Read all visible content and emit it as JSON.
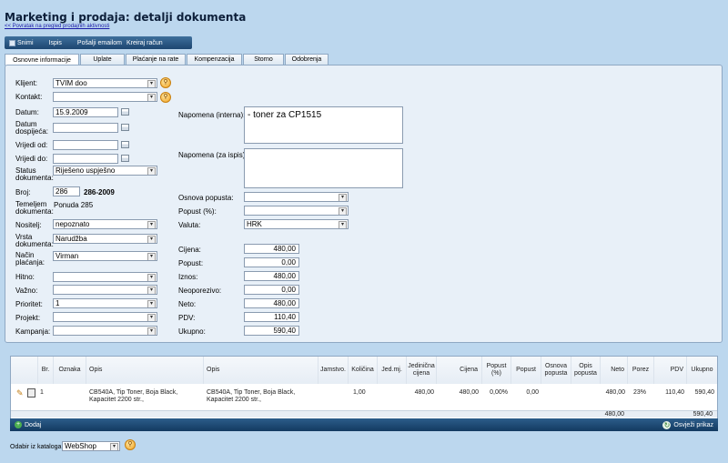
{
  "page": {
    "title": "Marketing i prodaja: detalji dokumenta",
    "back_link": "<< Povratak na pregled prodajnih aktivnosti"
  },
  "toolbar": {
    "save": "Snimi",
    "print": "Ispis",
    "email": "Pošalji emailom",
    "invoice": "Kreiraj račun"
  },
  "tabs": [
    "Osnovne informacije",
    "Uplate",
    "Plaćanje na rate",
    "Kompenzacija",
    "Storno",
    "Odobrenja"
  ],
  "form": {
    "klijent": {
      "label": "Klijent:",
      "value": "TVIM doo"
    },
    "kontakt": {
      "label": "Kontakt:",
      "value": ""
    },
    "datum": {
      "label": "Datum:",
      "value": "15.9.2009"
    },
    "datum_dospijeca": {
      "label": "Datum dospijeća:",
      "value": ""
    },
    "vrijedi_od": {
      "label": "Vrijedi od:",
      "value": ""
    },
    "vrijedi_do": {
      "label": "Vrijedi do:",
      "value": ""
    },
    "status": {
      "label": "Status dokumenta:",
      "value": "Riješeno uspješno"
    },
    "broj": {
      "label": "Broj:",
      "value": "286",
      "full": "286-2009"
    },
    "temeljem": {
      "label": "Temeljem dokumenta:",
      "value": "Ponuda 285"
    },
    "nositelj": {
      "label": "Nositelj:",
      "value": "nepoznato"
    },
    "vrsta": {
      "label": "Vrsta dokumenta:",
      "value": "Narudžba"
    },
    "nacin": {
      "label": "Način plaćanja:",
      "value": "Virman"
    },
    "hitno": {
      "label": "Hitno:",
      "value": ""
    },
    "vazno": {
      "label": "Važno:",
      "value": ""
    },
    "prioritet": {
      "label": "Prioritet:",
      "value": "1"
    },
    "projekt": {
      "label": "Projekt:",
      "value": ""
    },
    "kampanja": {
      "label": "Kampanja:",
      "value": ""
    },
    "napomena_interna": {
      "label": "Napomena (interna):",
      "value": "- toner za CP1515"
    },
    "napomena_ispis": {
      "label": "Napomena (za ispis):",
      "value": ""
    },
    "osnova_popusta": {
      "label": "Osnova popusta:",
      "value": ""
    },
    "popust_pct": {
      "label": "Popust (%):",
      "value": ""
    },
    "valuta": {
      "label": "Valuta:",
      "value": "HRK"
    },
    "cijena": {
      "label": "Cijena:",
      "value": "480,00"
    },
    "popust": {
      "label": "Popust:",
      "value": "0,00"
    },
    "iznos": {
      "label": "Iznos:",
      "value": "480,00"
    },
    "neoporezivo": {
      "label": "Neoporezivo:",
      "value": "0,00"
    },
    "neto": {
      "label": "Neto:",
      "value": "480,00"
    },
    "pdv": {
      "label": "PDV:",
      "value": "110,40"
    },
    "ukupno": {
      "label": "Ukupno:",
      "value": "590,40"
    }
  },
  "grid": {
    "columns": [
      "Br.",
      "Oznaka",
      "Opis",
      "Opis",
      "Jamstvo.",
      "Količina",
      "Jed.mj.",
      "Jedinična cijena",
      "Cijena",
      "Popust (%)",
      "Popust",
      "Osnova popusta",
      "Opis popusta",
      "Neto",
      "Porez",
      "PDV",
      "Ukupno"
    ],
    "rows": [
      {
        "br": "1",
        "oznaka": "",
        "opis": "CB540A, Tip Toner, Boja Black, Kapacitet 2200 str.,",
        "opis2": "CB540A, Tip Toner, Boja Black, Kapacitet 2200 str.,",
        "jamstvo": "",
        "kolicina": "1,00",
        "jedmj": "",
        "jedinicna": "480,00",
        "cijena": "480,00",
        "popust_pct": "0,00%",
        "popust": "0,00",
        "osnova": "",
        "opis_popusta": "",
        "neto": "480,00",
        "porez": "23%",
        "pdv": "110,40",
        "ukupno": "590,40"
      }
    ],
    "totals": {
      "neto": "480,00",
      "ukupno": "590,40"
    },
    "add_label": "Dodaj",
    "refresh_label": "Osvježi prikaz"
  },
  "catalog": {
    "label": "Odabir iz kataloga:",
    "value": "WebShop"
  }
}
